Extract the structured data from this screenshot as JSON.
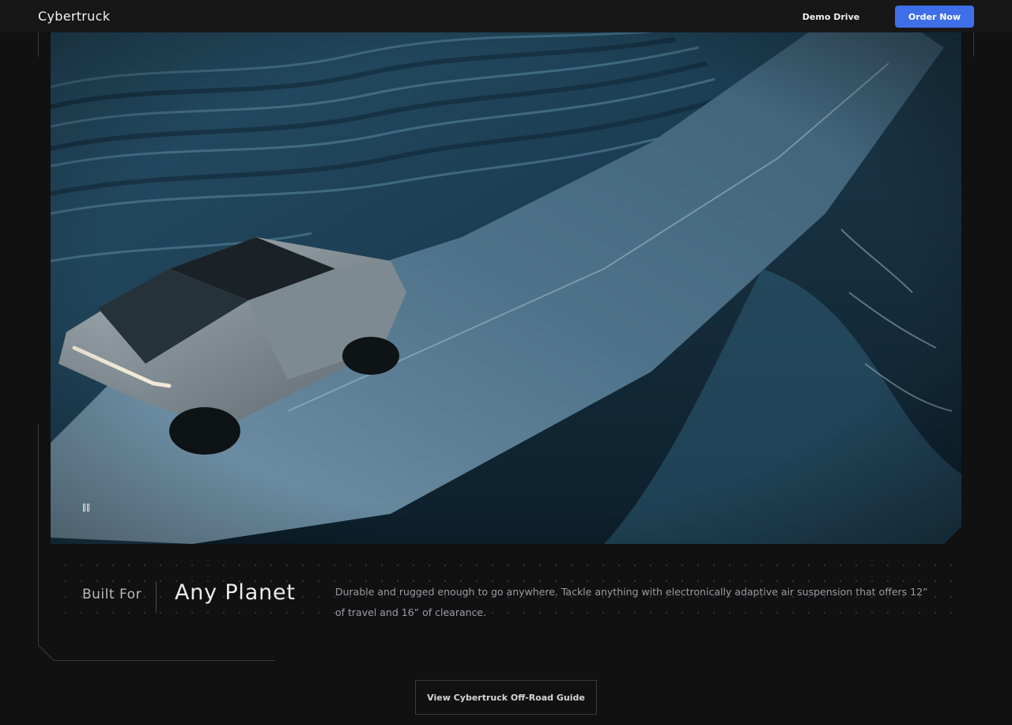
{
  "header": {
    "brand": "Cybertruck",
    "demo_drive_label": "Demo Drive",
    "order_now_label": "Order Now",
    "accent_color": "#3f6fe8"
  },
  "hero": {
    "media": "video of Cybertruck driving on snowy mountain road",
    "pause_icon": "pause-icon"
  },
  "feature": {
    "kicker": "Built For",
    "title": "Any Planet",
    "description": "Durable and rugged enough to go anywhere. Tackle anything with electronically adaptive air suspension that offers 12” of travel and 16” of clearance."
  },
  "cta": {
    "guide_label": "View Cybertruck Off-Road Guide"
  }
}
